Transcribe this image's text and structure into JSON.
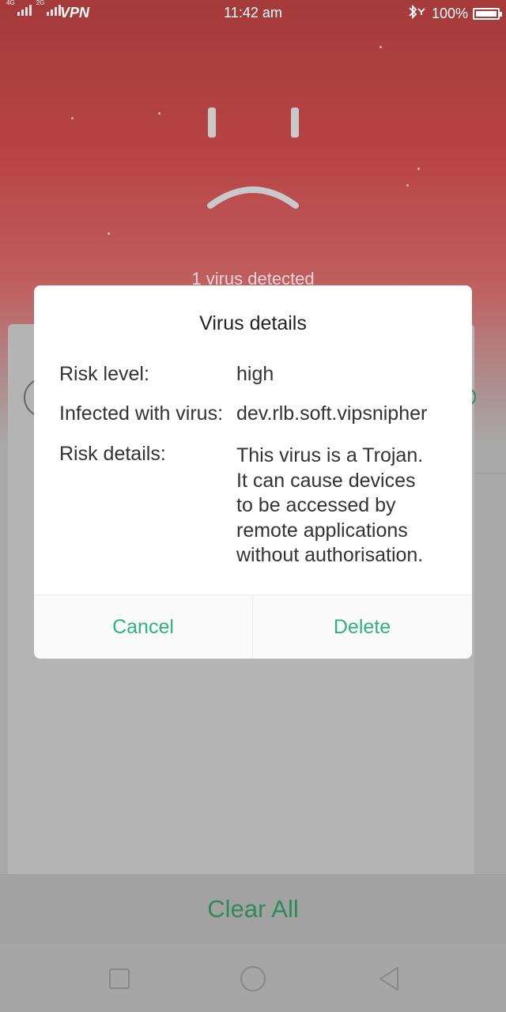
{
  "status_bar": {
    "network_1": "4G",
    "network_2": "2G",
    "vpn": "VPN",
    "time": "11:42 am",
    "battery": "100%",
    "icons": [
      "signal-icon",
      "bluetooth-icon",
      "battery-icon"
    ]
  },
  "background": {
    "detected_text": "1 virus detected"
  },
  "dialog": {
    "title": "Virus details",
    "risk_level_label": "Risk level:",
    "risk_level_value": "high",
    "infected_label": "Infected with virus:",
    "infected_value": "dev.rlb.soft.vipsnipher",
    "risk_details_label": "Risk details:",
    "risk_details_lines": [
      "This virus is a Trojan.",
      "It can cause devices",
      "to be accessed by",
      "remote applications",
      "without authorisation."
    ],
    "cancel_label": "Cancel",
    "delete_label": "Delete"
  },
  "footer": {
    "clear_all_label": "Clear All"
  },
  "navbar": {
    "icons": [
      "square-icon",
      "circle-icon",
      "back-triangle-icon"
    ]
  },
  "colors": {
    "accent_green": "#2fb37e",
    "clear_all_green": "#2e8a5d",
    "alert_red": "#a43a3a"
  }
}
